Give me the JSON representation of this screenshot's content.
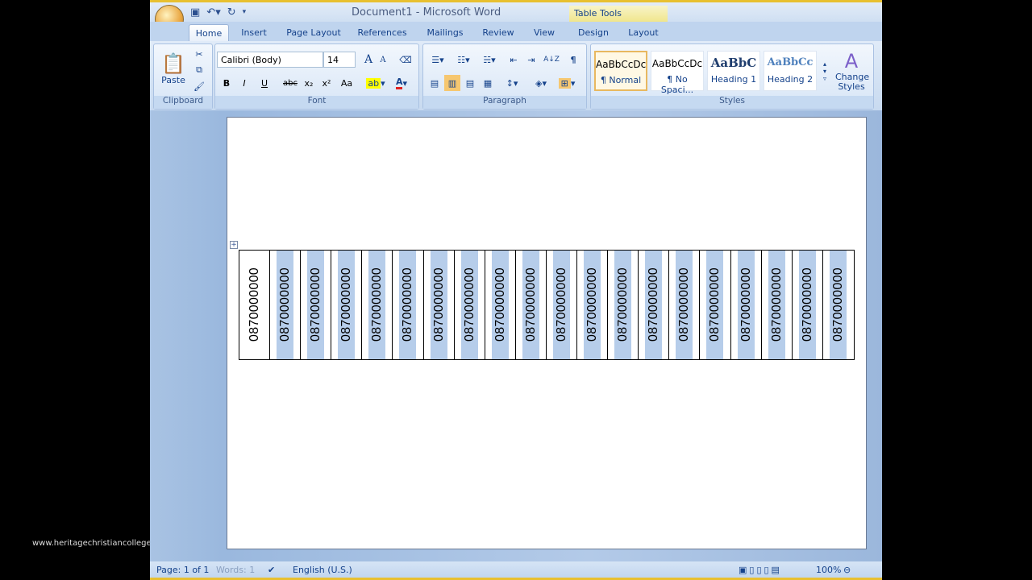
{
  "window": {
    "title": "Document1 - Microsoft Word",
    "contextual_tab": "Table Tools"
  },
  "tabs": [
    "Home",
    "Insert",
    "Page Layout",
    "References",
    "Mailings",
    "Review",
    "View",
    "Design",
    "Layout"
  ],
  "active_tab": "Home",
  "clipboard": {
    "label": "Clipboard",
    "paste": "Paste"
  },
  "font": {
    "label": "Font",
    "name": "Calibri (Body)",
    "size": "14",
    "bold": "B",
    "italic": "I",
    "underline": "U",
    "strike": "abc",
    "sub": "x₂",
    "sup": "x²",
    "case": "Aa",
    "grow": "A",
    "shrink": "A",
    "highlight_color": "#ffff00",
    "font_color": "#e02020"
  },
  "paragraph": {
    "label": "Paragraph",
    "pilcrow": "¶",
    "sort": "A↓Z"
  },
  "styles": {
    "label": "Styles",
    "items": [
      {
        "preview": "AaBbCcDc",
        "name": "¶ Normal"
      },
      {
        "preview": "AaBbCcDc",
        "name": "¶ No Spaci..."
      },
      {
        "preview": "AaBbC",
        "name": "Heading 1"
      },
      {
        "preview": "AaBbCc",
        "name": "Heading 2"
      }
    ],
    "change": "Change Styles"
  },
  "table": {
    "cells": [
      "0870000000",
      "0870000000",
      "0870000000",
      "0870000000",
      "0870000000",
      "0870000000",
      "0870000000",
      "0870000000",
      "0870000000",
      "0870000000",
      "0870000000",
      "0870000000",
      "0870000000",
      "0870000000",
      "0870000000",
      "0870000000",
      "0870000000",
      "0870000000",
      "0870000000",
      "0870000000"
    ],
    "highlight_color": "#b6cdea"
  },
  "status": {
    "page": "Page: 1 of 1",
    "words": "Words: 1",
    "language": "English (U.S.)",
    "zoom": "100%"
  },
  "watermark": "www.heritagechristiancollege.com"
}
